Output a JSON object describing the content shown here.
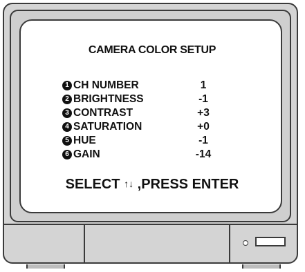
{
  "menu": {
    "title": "CAMERA COLOR SETUP",
    "items": [
      {
        "num": "1",
        "label": "CH NUMBER",
        "value": "1"
      },
      {
        "num": "2",
        "label": "BRIGHTNESS",
        "value": "-1"
      },
      {
        "num": "3",
        "label": "CONTRAST",
        "value": "+3"
      },
      {
        "num": "4",
        "label": "SATURATION",
        "value": "+0"
      },
      {
        "num": "5",
        "label": "HUE",
        "value": "-1"
      },
      {
        "num": "6",
        "label": "GAIN",
        "value": "-14"
      }
    ],
    "footer_select": "SELECT",
    "footer_arrows": "↑↓",
    "footer_press": ",PRESS  ENTER"
  },
  "colors": {
    "screen_bg": "#ffffff",
    "bezel": "#d4d4d4",
    "text": "#111111"
  },
  "icons": {
    "arrows": "up-down-arrows-icon",
    "led": "power-led-icon",
    "slot": "power-slot-icon"
  }
}
